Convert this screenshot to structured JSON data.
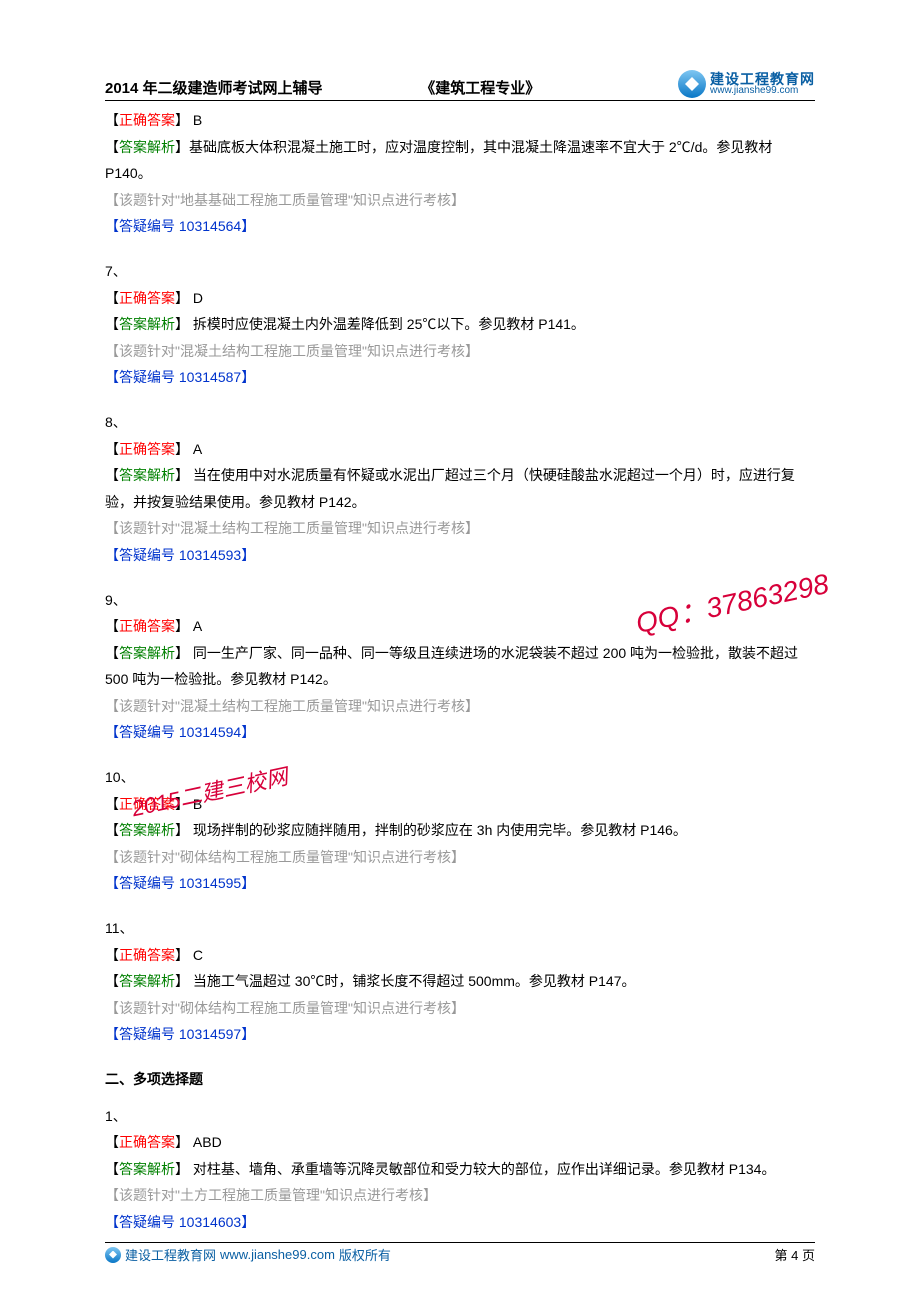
{
  "header": {
    "left": "2014 年二级建造师考试网上辅导",
    "center": "《建筑工程专业》",
    "logo_cn": "建设工程教育网",
    "logo_url": "www.jianshe99.com"
  },
  "labels": {
    "correct_answer": "正确答案",
    "analysis": "答案解析",
    "doubt_prefix": "【答疑编号 ",
    "doubt_suffix": "】",
    "topic_prefix": "【该题针对\"",
    "topic_suffix": "\"知识点进行考核】"
  },
  "questions": [
    {
      "num": "",
      "answer": " B",
      "analysis": "基础底板大体积混凝土施工时，应对温度控制，其中混凝土降温速率不宜大于 2℃/d。参见教材P140。",
      "topic": "地基基础工程施工质量管理",
      "doubt": "10314564"
    },
    {
      "num": "7、",
      "answer": " D",
      "analysis": " 拆模时应使混凝土内外温差降低到 25℃以下。参见教材 P141。",
      "topic": "混凝土结构工程施工质量管理",
      "doubt": "10314587"
    },
    {
      "num": "8、",
      "answer": " A",
      "analysis": " 当在使用中对水泥质量有怀疑或水泥出厂超过三个月（快硬硅酸盐水泥超过一个月）时，应进行复验，并按复验结果使用。参见教材 P142。",
      "topic": "混凝土结构工程施工质量管理",
      "doubt": "10314593"
    },
    {
      "num": "9、",
      "answer": " A",
      "analysis": " 同一生产厂家、同一品种、同一等级且连续进场的水泥袋装不超过 200 吨为一检验批，散装不超过 500 吨为一检验批。参见教材 P142。",
      "topic": "混凝土结构工程施工质量管理",
      "doubt": "10314594"
    },
    {
      "num": "10、",
      "answer": " B",
      "analysis": " 现场拌制的砂浆应随拌随用，拌制的砂浆应在 3h 内使用完毕。参见教材 P146。",
      "topic": "砌体结构工程施工质量管理",
      "doubt": "10314595"
    },
    {
      "num": "11、",
      "answer": " C",
      "analysis": " 当施工气温超过 30℃时，铺浆长度不得超过 500mm。参见教材 P147。",
      "topic": "砌体结构工程施工质量管理",
      "doubt": "10314597"
    }
  ],
  "section2": {
    "title": "二、多项选择题",
    "items": [
      {
        "num": "1、",
        "answer": " ABD",
        "analysis": " 对柱基、墙角、承重墙等沉降灵敏部位和受力较大的部位，应作出详细记录。参见教材 P134。",
        "topic": "土方工程施工质量管理",
        "doubt": "10314603"
      }
    ]
  },
  "watermarks": {
    "qq": "QQ：37863298",
    "year": "2015二建三校网"
  },
  "footer": {
    "site": "建设工程教育网",
    "url": "www.jianshe99.com",
    "copy": "版权所有",
    "page": "第 4 页"
  }
}
